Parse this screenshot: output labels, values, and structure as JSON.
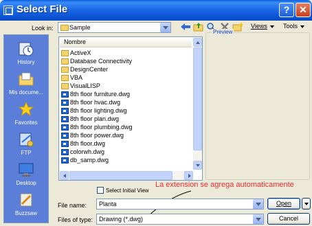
{
  "window": {
    "title": "Select File"
  },
  "look_in": {
    "label": "Look in:",
    "value": "Sample"
  },
  "toolbar": {
    "views_label": "Views",
    "tools_label": "Tools"
  },
  "places": [
    {
      "label": "History",
      "icon": "history-icon"
    },
    {
      "label": "Mis docume...",
      "icon": "my-documents-icon"
    },
    {
      "label": "Favorites",
      "icon": "favorites-icon"
    },
    {
      "label": "FTP",
      "icon": "ftp-icon"
    },
    {
      "label": "Desktop",
      "icon": "desktop-icon"
    },
    {
      "label": "Buzzsaw",
      "icon": "buzzsaw-icon"
    }
  ],
  "filelist": {
    "column_header": "Nombre",
    "items": [
      {
        "name": "ActiveX",
        "type": "folder"
      },
      {
        "name": "Database Connectivity",
        "type": "folder"
      },
      {
        "name": "DesignCenter",
        "type": "folder"
      },
      {
        "name": "VBA",
        "type": "folder"
      },
      {
        "name": "VisualLISP",
        "type": "folder"
      },
      {
        "name": "8th floor furniture.dwg",
        "type": "dwg"
      },
      {
        "name": "8th floor hvac.dwg",
        "type": "dwg"
      },
      {
        "name": "8th floor lighting.dwg",
        "type": "dwg"
      },
      {
        "name": "8th floor plan.dwg",
        "type": "dwg"
      },
      {
        "name": "8th floor plumbing.dwg",
        "type": "dwg"
      },
      {
        "name": "8th floor power.dwg",
        "type": "dwg"
      },
      {
        "name": "8th floor.dwg",
        "type": "dwg"
      },
      {
        "name": "colorwh.dwg",
        "type": "dwg"
      },
      {
        "name": "db_samp.dwg",
        "type": "dwg"
      }
    ]
  },
  "preview": {
    "label": "Preview"
  },
  "select_initial_view": {
    "label": "Select Initial View",
    "checked": false
  },
  "annotation": {
    "text": "La extension se agrega automaticamente",
    "color": "#E03030"
  },
  "file_name": {
    "label": "File name:",
    "value": "Planta"
  },
  "files_of_type": {
    "label": "Files of type:",
    "value": "Drawing (*.dwg)"
  },
  "buttons": {
    "open": "Open",
    "cancel": "Cancel"
  },
  "colors": {
    "accent": "#0A5FE0",
    "places_bar": "#5B7ED8",
    "annotation": "#E03030"
  }
}
